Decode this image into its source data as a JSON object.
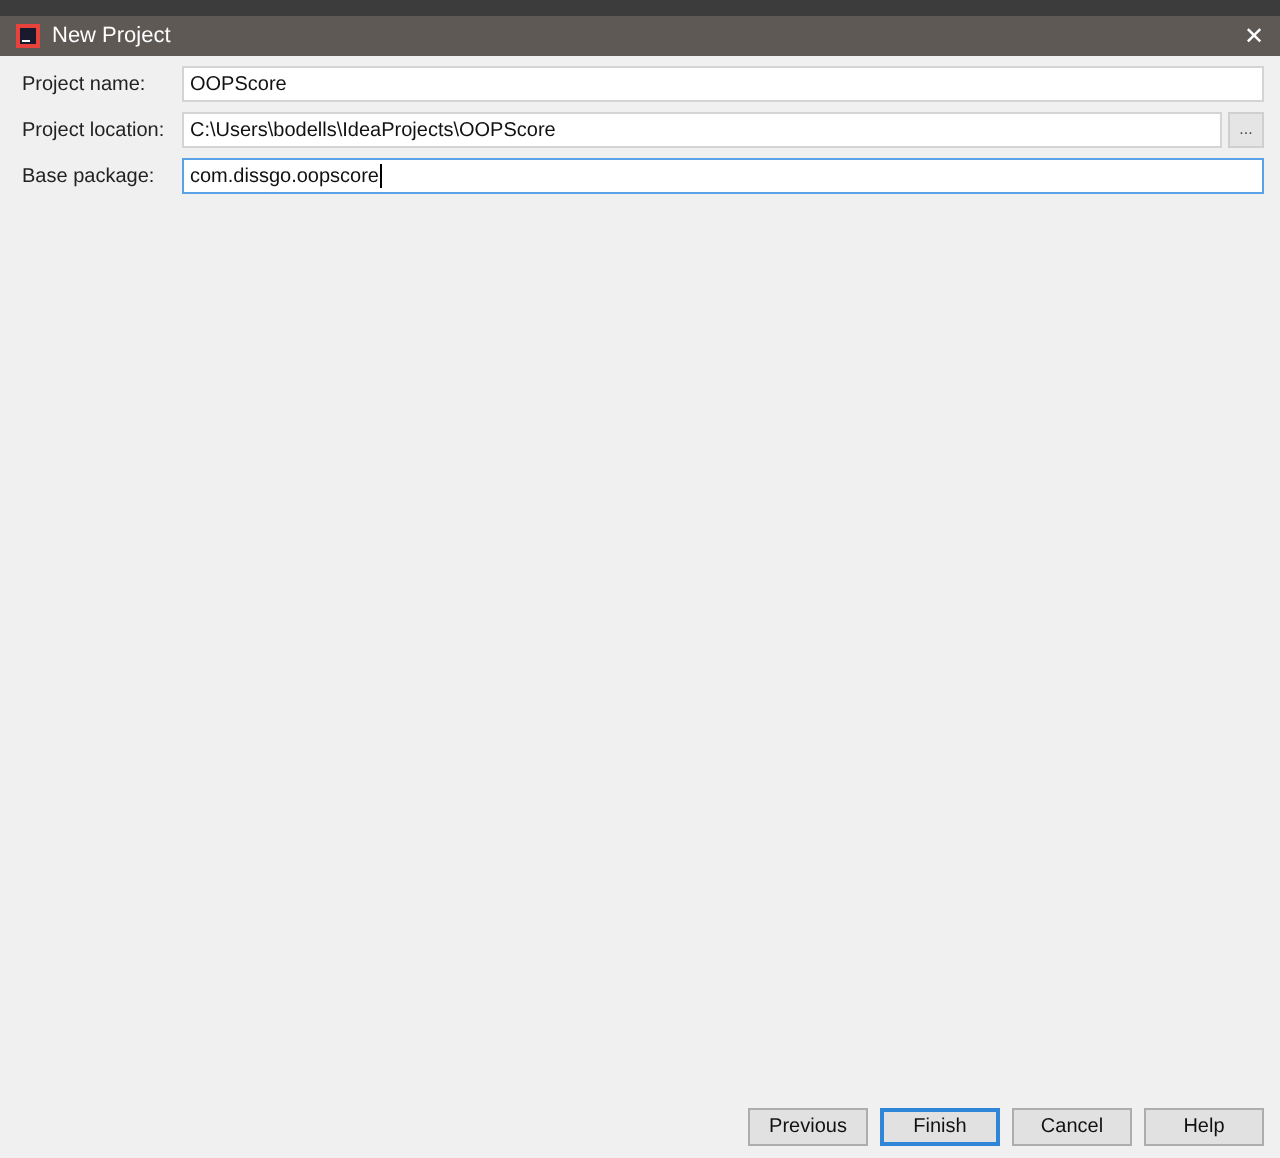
{
  "window": {
    "title": "New Project",
    "close": "✕"
  },
  "fields": [
    {
      "label": "Project name:",
      "value": "OOPScore",
      "focused": false
    },
    {
      "label": "Project location:",
      "value": "C:\\Users\\bodells\\IdeaProjects\\OOPScore",
      "focused": false,
      "browse": "..."
    },
    {
      "label": "Base package:",
      "value": "com.dissgo.oopscore",
      "focused": true
    }
  ],
  "buttons": [
    {
      "label": "Previous",
      "focused": false
    },
    {
      "label": "Finish",
      "focused": true
    },
    {
      "label": "Cancel",
      "focused": false
    },
    {
      "label": "Help",
      "focused": false
    }
  ]
}
